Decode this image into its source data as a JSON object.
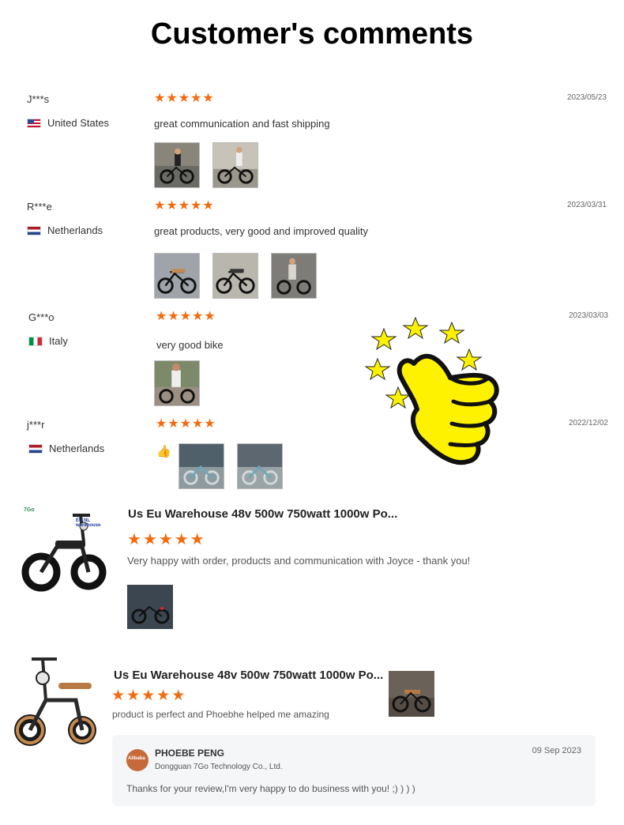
{
  "page": {
    "title": "Customer's comments"
  },
  "reviews": [
    {
      "name": "J***s",
      "country": "United States",
      "flag": "us",
      "rating": 5,
      "date": "2023/05/23",
      "text": "great communication and fast shipping",
      "photos": 2
    },
    {
      "name": "R***e",
      "country": "Netherlands",
      "flag": "nl",
      "rating": 5,
      "date": "2023/03/31",
      "text": "great products, very good and improved quality",
      "photos": 3
    },
    {
      "name": "G***o",
      "country": "Italy",
      "flag": "it",
      "rating": 5,
      "date": "2023/03/03",
      "text": "very good bike",
      "photos": 1
    },
    {
      "name": "j***r",
      "country": "Netherlands",
      "flag": "nl",
      "rating": 5,
      "date": "2022/12/02",
      "text": "",
      "photos": 2
    }
  ],
  "products": [
    {
      "title": "Us Eu Warehouse 48v 500w 750watt 1000w Po...",
      "rating": 5,
      "text": "Very happy with order, products and communication with Joyce - thank you!",
      "badge": "7Go",
      "badge_text": "EU NL warehouse"
    },
    {
      "title": "Us Eu Warehouse 48v 500w 750watt 1000w Po...",
      "rating": 5,
      "text": "product is perfect and Phoebhe helped me amazing"
    }
  ],
  "reply": {
    "name": "PHOEBE PENG",
    "company": "Dongguan 7Go Technology Co., Ltd.",
    "date": "09 Sep 2023",
    "text": "Thanks for your review,I'm very happy to do business with you! ;) ) ) )",
    "avatar_text": "Alibaba"
  },
  "colors": {
    "star": "#f26b0f",
    "thumbs_yellow": "#fff200"
  }
}
